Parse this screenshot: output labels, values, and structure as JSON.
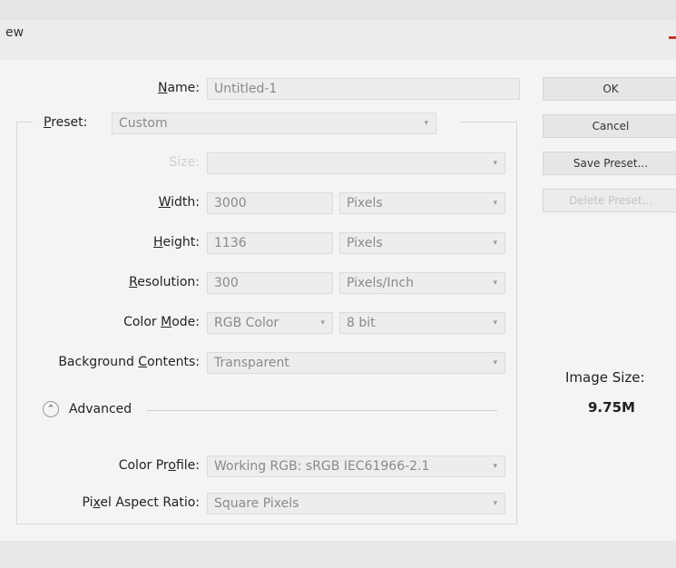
{
  "window": {
    "title": "ew"
  },
  "form": {
    "name": {
      "label": "Name:",
      "value": "Untitled-1"
    },
    "preset": {
      "label": "Preset:",
      "value": "Custom"
    },
    "size": {
      "label": "Size:",
      "value": ""
    },
    "width": {
      "label": "Width:",
      "value": "3000",
      "unit": "Pixels"
    },
    "height": {
      "label": "Height:",
      "value": "1136",
      "unit": "Pixels"
    },
    "resolution": {
      "label": "Resolution:",
      "value": "300",
      "unit": "Pixels/Inch"
    },
    "color_mode": {
      "label": "Color Mode:",
      "value": "RGB Color",
      "depth": "8 bit"
    },
    "background": {
      "label": "Background Contents:",
      "value": "Transparent"
    },
    "advanced": {
      "label": "Advanced"
    },
    "color_profile": {
      "label": "Color Profile:",
      "value": "Working RGB:  sRGB IEC61966-2.1"
    },
    "pixel_aspect": {
      "label": "Pixel Aspect Ratio:",
      "value": "Square Pixels"
    }
  },
  "buttons": {
    "ok": "OK",
    "cancel": "Cancel",
    "save_preset": "Save Preset...",
    "delete_preset": "Delete Preset..."
  },
  "image_size": {
    "label": "Image Size:",
    "value": "9.75M"
  },
  "icons": {
    "dropdown": "chevron-down-icon",
    "advanced": "collapse-chevrons-icon",
    "close": "close-icon"
  }
}
